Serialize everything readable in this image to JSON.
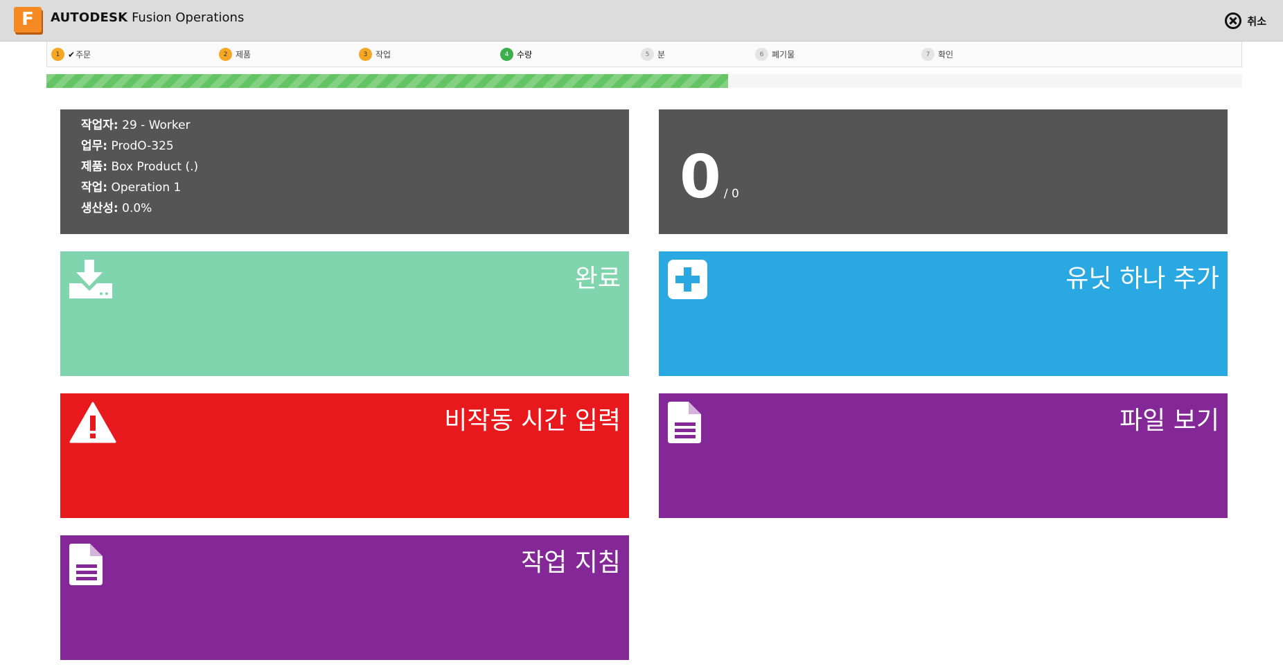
{
  "header": {
    "brand_bold": "AUTODESK",
    "brand_rest": "Fusion Operations",
    "logo_letter": "F",
    "cancel_label": "취소"
  },
  "steps": [
    {
      "num": "1",
      "label": "주문",
      "state": "done",
      "check": "✔"
    },
    {
      "num": "2",
      "label": "제품",
      "state": "done"
    },
    {
      "num": "3",
      "label": "작업",
      "state": "done"
    },
    {
      "num": "4",
      "label": "수량",
      "state": "current"
    },
    {
      "num": "5",
      "label": "분",
      "state": "pending"
    },
    {
      "num": "6",
      "label": "폐기물",
      "state": "pending"
    },
    {
      "num": "7",
      "label": "확인",
      "state": "pending"
    }
  ],
  "progress": {
    "value_percent": 57
  },
  "info": {
    "worker_key": "작업자:",
    "worker_val": "29 - Worker",
    "job_key": "업무:",
    "job_val": "ProdO-325",
    "product_key": "제품:",
    "product_val": "Box Product (.)",
    "operation_key": "작업:",
    "operation_val": "Operation 1",
    "productivity_key": "생산성:",
    "productivity_val": "0.0%"
  },
  "quantity": {
    "count": "0",
    "total": "/ 0"
  },
  "tiles": {
    "complete": "완료",
    "add_unit": "유닛 하나 추가",
    "downtime": "비작동 시간 입력",
    "view_files": "파일 보기",
    "work_instructions": "작업 지침"
  },
  "colors": {
    "green": "#80d5ae",
    "blue": "#29a8e1",
    "red": "#e8191d",
    "purple": "#842897",
    "dark": "#555555",
    "progress": "#62c462"
  }
}
